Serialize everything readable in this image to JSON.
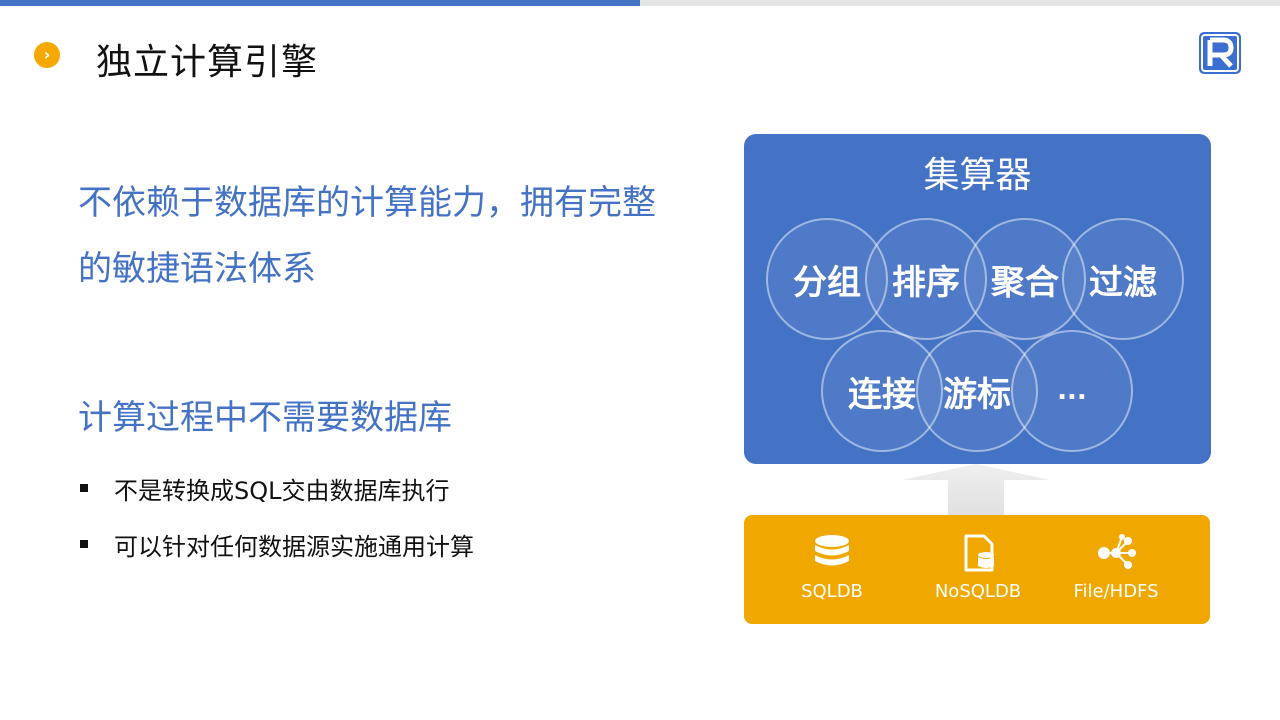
{
  "header": {
    "bullet_symbol": "›",
    "title": "独立计算引擎",
    "logo_icon": "raqsoft-r-logo-icon",
    "progress": 0.5
  },
  "content": {
    "lead": "不依赖于数据库的计算能力，拥有完整的敏捷语法体系",
    "section_heading": "计算过程中不需要数据库",
    "bullets": [
      "不是转换成SQL交由数据库执行",
      "可以针对任何数据源实施通用计算"
    ]
  },
  "diagram": {
    "engine_title": "集算器",
    "operations": [
      "分组",
      "排序",
      "聚合",
      "过滤",
      "连接",
      "游标",
      "..."
    ],
    "sources": [
      {
        "label": "SQLDB",
        "icon": "database-icon"
      },
      {
        "label": "NoSQLDB",
        "icon": "nosql-file-database-icon"
      },
      {
        "label": "File/HDFS",
        "icon": "hdfs-network-icon"
      }
    ]
  },
  "colors": {
    "accent_blue": "#4472c4",
    "engine_panel": "#4472c4",
    "source_panel": "#f0a800",
    "bullet_orange": "#f5a800"
  }
}
